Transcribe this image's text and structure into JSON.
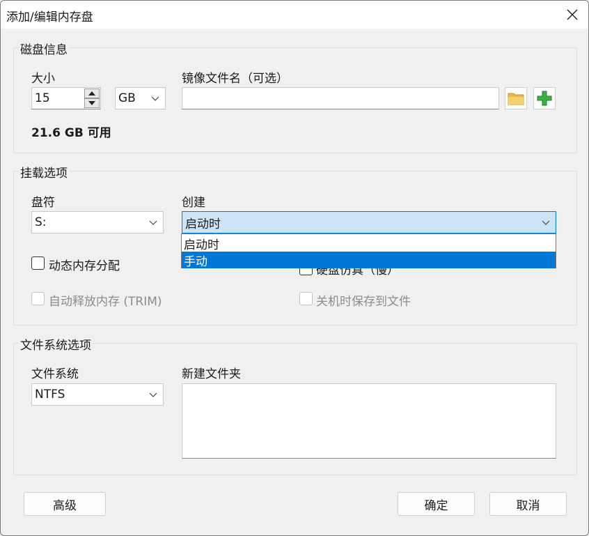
{
  "window": {
    "title": "添加/编辑内存盘"
  },
  "disk_info": {
    "group_title": "磁盘信息",
    "size_label": "大小",
    "size_value": "15",
    "unit_value": "GB",
    "available_text": "21.6 GB 可用",
    "image_label": "镜像文件名（可选）",
    "image_value": ""
  },
  "mount": {
    "group_title": "挂载选项",
    "drive_label": "盘符",
    "drive_value": "S:",
    "create_label": "创建",
    "create_value": "启动时",
    "create_options": [
      "启动时",
      "手动"
    ],
    "create_selected_index": 1,
    "dynamic_memory_label": "动态内存分配",
    "dynamic_memory_checked": false,
    "hidden_option_label_partial": "硬盘仿真（慢）",
    "hidden_option_checked": false,
    "trim_label": "自动释放内存 (TRIM)",
    "trim_checked": false,
    "save_on_shutdown_label": "关机时保存到文件",
    "save_on_shutdown_checked": false
  },
  "filesystem": {
    "group_title": "文件系统选项",
    "fs_label": "文件系统",
    "fs_value": "NTFS",
    "new_folder_label": "新建文件夹",
    "new_folder_value": ""
  },
  "buttons": {
    "advanced": "高级",
    "ok": "确定",
    "cancel": "取消"
  },
  "icons": {
    "close": "close-icon",
    "folder": "folder-icon",
    "add": "plus-icon",
    "chevron": "chevron-down-icon"
  },
  "colors": {
    "accent": "#0078d7",
    "combo_highlight": "#cce4f7",
    "folder": "#f2c94c",
    "add": "#3cb043"
  }
}
